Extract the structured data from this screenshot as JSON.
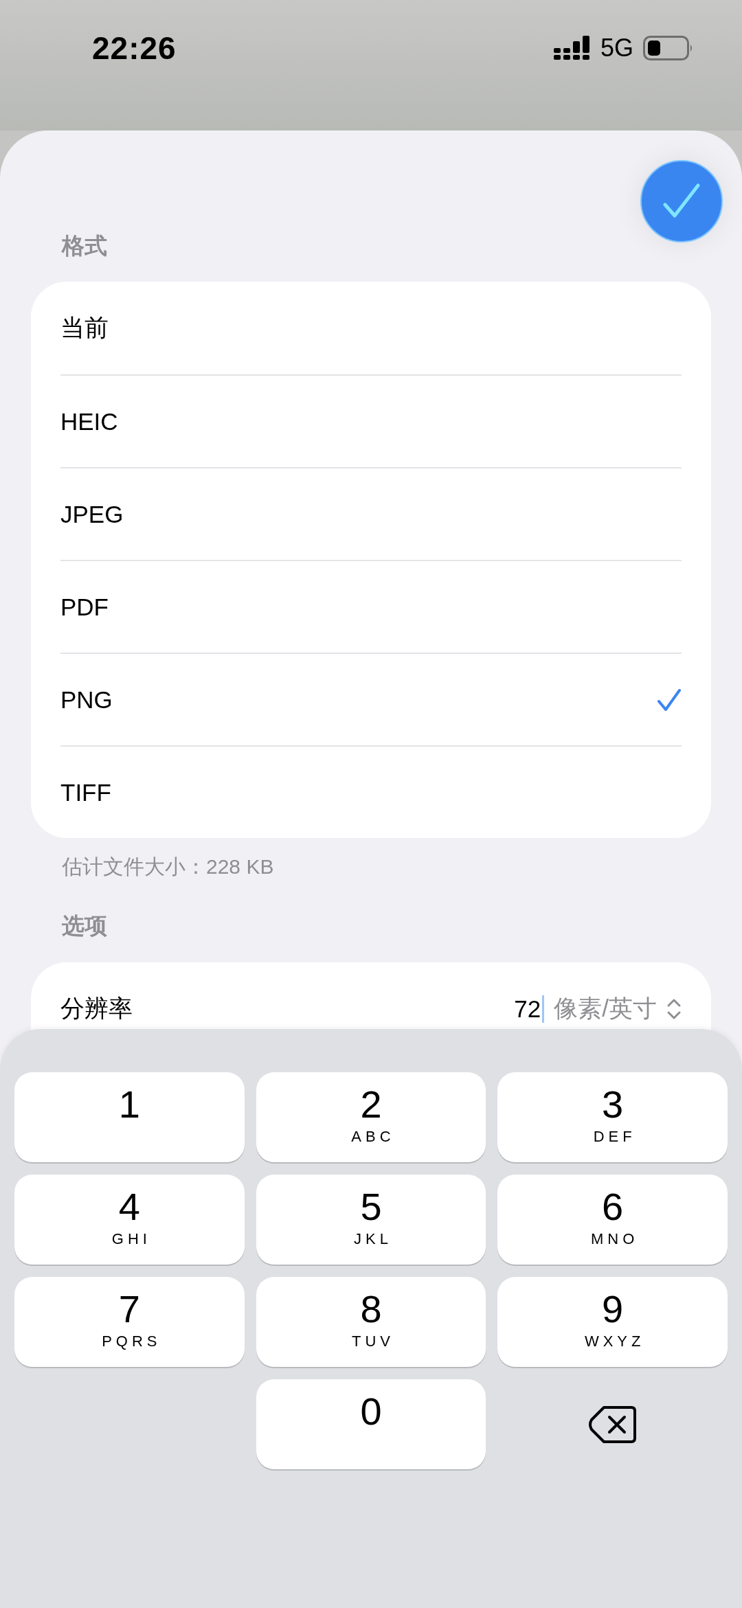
{
  "status_bar": {
    "time": "22:26",
    "network": "5G"
  },
  "format_section": {
    "title": "格式",
    "options": [
      {
        "label": "当前",
        "selected": false
      },
      {
        "label": "HEIC",
        "selected": false
      },
      {
        "label": "JPEG",
        "selected": false
      },
      {
        "label": "PDF",
        "selected": false
      },
      {
        "label": "PNG",
        "selected": true
      },
      {
        "label": "TIFF",
        "selected": false
      }
    ],
    "footer": "估计文件大小：228 KB"
  },
  "options_section": {
    "title": "选项",
    "resolution": {
      "label": "分辨率",
      "value": "72",
      "unit": "像素/英寸"
    }
  },
  "keypad": {
    "keys": [
      {
        "kind": "digit",
        "digit": "1"
      },
      {
        "kind": "digit",
        "digit": "2",
        "letters": "ABC"
      },
      {
        "kind": "digit",
        "digit": "3",
        "letters": "DEF"
      },
      {
        "kind": "digit",
        "digit": "4",
        "letters": "GHI"
      },
      {
        "kind": "digit",
        "digit": "5",
        "letters": "JKL"
      },
      {
        "kind": "digit",
        "digit": "6",
        "letters": "MNO"
      },
      {
        "kind": "digit",
        "digit": "7",
        "letters": "PQRS"
      },
      {
        "kind": "digit",
        "digit": "8",
        "letters": "TUV"
      },
      {
        "kind": "digit",
        "digit": "9",
        "letters": "WXYZ"
      },
      {
        "kind": "digit",
        "digit": "0"
      },
      {
        "kind": "delete"
      }
    ]
  }
}
